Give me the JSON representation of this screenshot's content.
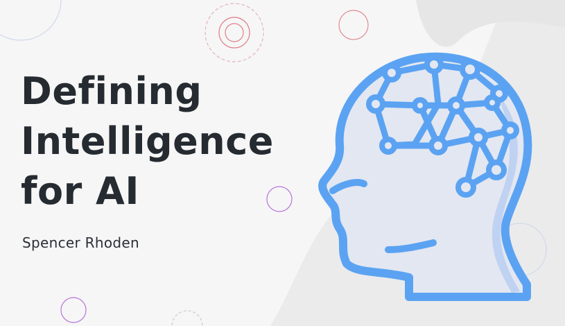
{
  "slide": {
    "title_lines": [
      "Defining",
      "Intelligence",
      "for AI"
    ],
    "author": "Spencer Rhoden"
  },
  "icons": {
    "main_illustration": "ai-brain-head-icon",
    "decorations": [
      "circle-outline-icon",
      "gear-outline-icon",
      "concentric-circles-icon"
    ]
  },
  "colors": {
    "title": "#252b31",
    "accent_blue": "#5ba3f2",
    "head_fill": "#e4e8f2",
    "background": "#f6f6f7",
    "background_blob": "#e9e9ea"
  }
}
